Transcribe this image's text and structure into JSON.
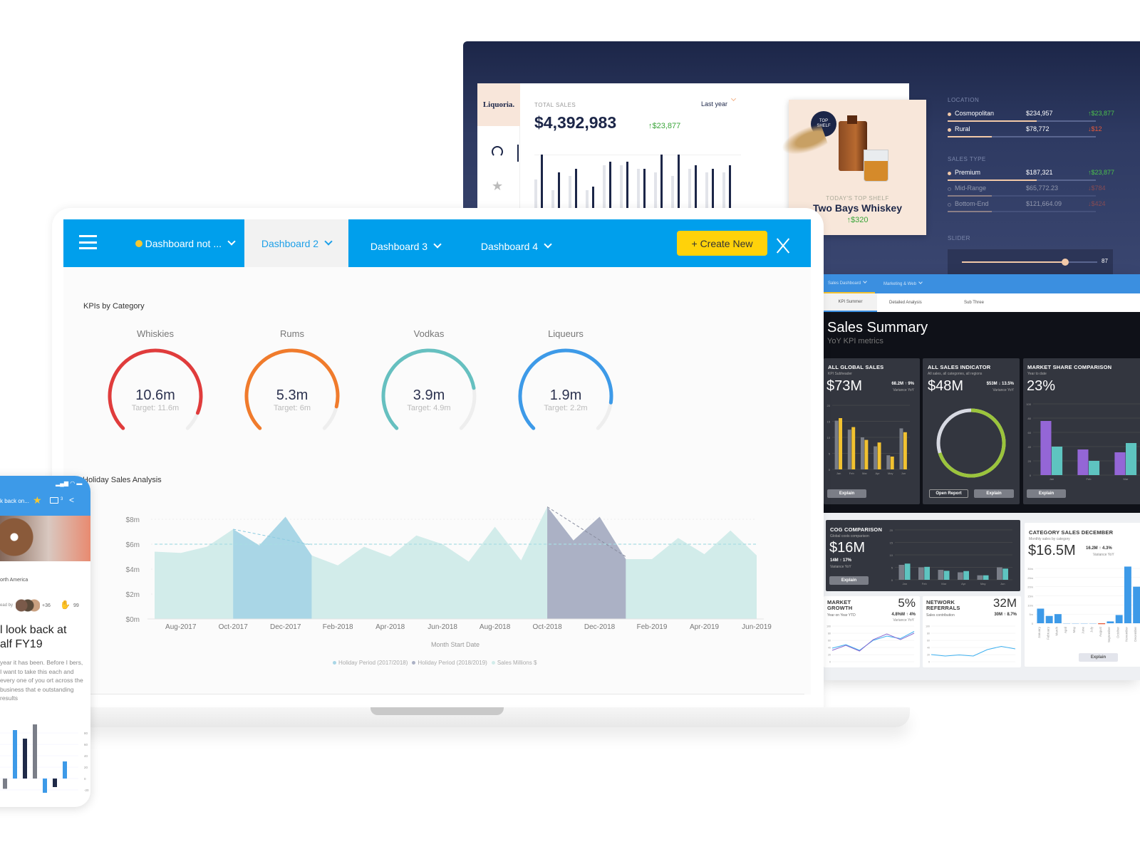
{
  "monitor": {
    "logo": "Liquoria.",
    "total_sales_label": "TOTAL SALES",
    "total_sales_value": "$4,392,983",
    "total_sales_change": "↑$23,877",
    "period_select": "Last year",
    "sidebar_icons": [
      "gauge-icon",
      "star-icon"
    ],
    "bars": [
      {
        "light": 45,
        "dark": 80
      },
      {
        "light": 30,
        "dark": 55
      },
      {
        "light": 50,
        "dark": 60
      },
      {
        "light": 30,
        "dark": 35
      },
      {
        "light": 65,
        "dark": 70
      },
      {
        "light": 65,
        "dark": 70
      },
      {
        "light": 60,
        "dark": 60
      },
      {
        "light": 55,
        "dark": 80
      },
      {
        "light": 50,
        "dark": 80
      },
      {
        "light": 60,
        "dark": 65
      },
      {
        "light": 55,
        "dark": 60
      },
      {
        "light": 55,
        "dark": 65
      }
    ],
    "product": {
      "badge": "TOP SHELF",
      "caption": "TODAY'S TOP SHELF",
      "name": "Two Bays Whiskey",
      "change": "↑$320"
    },
    "location_label": "LOCATION",
    "location": [
      {
        "name": "Cosmopolitan",
        "value": "$234,957",
        "change": "↑$23,877",
        "fill": 0.6,
        "active": true
      },
      {
        "name": "Rural",
        "value": "$78,772",
        "change": "↓$12",
        "fill": 0.3,
        "active": true
      }
    ],
    "sales_type_label": "SALES TYPE",
    "sales_type": [
      {
        "name": "Premium",
        "value": "$187,321",
        "change": "↑$23,877",
        "fill": 0.6,
        "active": true
      },
      {
        "name": "Mid-Range",
        "value": "$65,772.23",
        "change": "↓$784",
        "fill": 0.3,
        "active": false
      },
      {
        "name": "Bottom-End",
        "value": "$121,664.09",
        "change": "↓$424",
        "fill": 0.3,
        "active": false
      }
    ],
    "slider_label": "SLIDER",
    "slider_value": "87"
  },
  "laptop": {
    "tabs": [
      {
        "label": "Dashboard not ...",
        "active": false,
        "dot": true
      },
      {
        "label": "Dashboard 2",
        "active": true
      },
      {
        "label": "Dashboard 3",
        "active": false
      },
      {
        "label": "Dashboard 4",
        "active": false
      }
    ],
    "create_new": "+ Create New",
    "kpi_title": "KPIs by Category",
    "gauges": [
      {
        "label": "Whiskies",
        "value": "10.6m",
        "target": "Target: 11.6m",
        "fraction": 0.914,
        "color": "#e03c3c"
      },
      {
        "label": "Rums",
        "value": "5.3m",
        "target": "Target: 6m",
        "fraction": 0.883,
        "color": "#f07b2c"
      },
      {
        "label": "Vodkas",
        "value": "3.9m",
        "target": "Target: 4.9m",
        "fraction": 0.796,
        "color": "#66c0c0"
      },
      {
        "label": "Liqueurs",
        "value": "1.9m",
        "target": "Target: 2.2m",
        "fraction": 0.864,
        "color": "#3d9ae8"
      }
    ]
  },
  "chart_data": {
    "type": "area",
    "title": "Holiday Sales Analysis",
    "xlabel": "Month Start Date",
    "ylabel": "",
    "x": [
      "Jul-2017",
      "Aug-2017",
      "Sep-2017",
      "Oct-2017",
      "Nov-2017",
      "Dec-2017",
      "Jan-2018",
      "Feb-2018",
      "Mar-2018",
      "Apr-2018",
      "May-2018",
      "Jun-2018",
      "Jul-2018",
      "Aug-2018",
      "Sep-2018",
      "Oct-2018",
      "Nov-2018",
      "Dec-2018",
      "Jan-2019",
      "Feb-2019",
      "Mar-2019",
      "Apr-2019",
      "May-2019",
      "Jun-2019"
    ],
    "x_ticks": [
      "Aug-2017",
      "Oct-2017",
      "Dec-2017",
      "Feb-2018",
      "Apr-2018",
      "Jun-2018",
      "Aug-2018",
      "Oct-2018",
      "Dec-2018",
      "Feb-2019",
      "Apr-2019",
      "Jun-2019"
    ],
    "y_ticks": [
      "$0m",
      "$2m",
      "$4m",
      "$6m",
      "$8m"
    ],
    "ylim": [
      0,
      8
    ],
    "values": [
      5.4,
      5.3,
      5.8,
      7.2,
      5.9,
      8.2,
      5.1,
      4.3,
      5.8,
      5.0,
      6.7,
      6.0,
      4.6,
      7.4,
      4.7,
      9.0,
      6.3,
      8.2,
      4.8,
      4.8,
      6.5,
      5.2,
      7.1,
      5.1
    ],
    "average_line": 6,
    "series": [
      {
        "name": "Holiday Period (2017/2018)",
        "from": "Oct-2017",
        "to": "Jan-2018",
        "color": "#a9d6e6"
      },
      {
        "name": "Holiday Period (2018/2019)",
        "from": "Oct-2018",
        "to": "Jan-2019",
        "color": "#abb1c5"
      },
      {
        "name": "Sales Millions $",
        "color": "#d2ecea"
      }
    ],
    "legend": "bottom"
  },
  "rdash": {
    "nav": [
      {
        "label": "Sales Dashboard"
      },
      {
        "label": "Marketing & Web"
      }
    ],
    "subtabs": [
      "KPI Summer",
      "Detailed Analysis",
      "Sub Three"
    ],
    "title": "Sales Summary",
    "subtitle": "YoY KPI metrics",
    "global": {
      "title": "ALL GLOBAL SALES",
      "sub": "KPI Subheader",
      "big": "$73M",
      "var": "68.2M ↑ 9%",
      "var_label": "Variance YoY",
      "explain": "Explain",
      "months": [
        "Jan",
        "Feb",
        "Mar",
        "Apr",
        "May",
        "Jun"
      ],
      "gray": [
        19,
        15.5,
        12.5,
        9,
        5.5,
        16
      ],
      "yellow": [
        20,
        16.5,
        11.5,
        10.5,
        5,
        14.5
      ],
      "ticks": [
        "0",
        "5",
        "10",
        "15",
        "20"
      ]
    },
    "indicator": {
      "title": "ALL SALES INDICATOR",
      "sub": "All sales, all categories, all regions",
      "big": "$48M",
      "var": "$53M ↓ 13.5%",
      "var_label": "Variance YoY",
      "open": "Open Report",
      "explain": "Explain",
      "fraction": 0.7
    },
    "share": {
      "title": "MARKET SHARE COMPARISON",
      "sub": "Year to date",
      "big": "23%",
      "explain": "Explain",
      "months": [
        "Jan",
        "Feb",
        "Mar"
      ],
      "purple": [
        76,
        36,
        32
      ],
      "teal": [
        40,
        20,
        45
      ],
      "ticks": [
        "0",
        "20",
        "40",
        "60",
        "80",
        "100"
      ]
    },
    "cog": {
      "title": "COG COMPARISON",
      "sub": "Global costs comparison",
      "big": "$16M",
      "var": "14M ↑ 17%",
      "var_label": "Variance YoY",
      "explain": "Explain",
      "months": [
        "Jan",
        "Feb",
        "Mar",
        "Apr",
        "May",
        "Jun"
      ],
      "gray": [
        6,
        5,
        4,
        3,
        1.8,
        5
      ],
      "teal": [
        6.5,
        5.2,
        3.6,
        3.5,
        1.8,
        4.5
      ],
      "ticks": [
        "0",
        "5",
        "10",
        "15",
        "20"
      ]
    },
    "category": {
      "title": "CATEGORY SALES DECEMBER",
      "sub": "Monthly sales by category",
      "big": "$16.5M",
      "var": "16.2M ↑ 4.3%",
      "var_label": "Variance YoY",
      "explain": "Explain",
      "months": [
        "January",
        "February",
        "March",
        "April",
        "May",
        "June",
        "July",
        "August",
        "September",
        "October",
        "November",
        "December"
      ],
      "values": [
        8,
        4,
        5,
        0,
        0,
        0,
        0,
        -0.5,
        1,
        4.5,
        31,
        20
      ],
      "ticks": [
        "0",
        "5m",
        "10m",
        "15m",
        "20m",
        "25m",
        "30m"
      ]
    },
    "growth": {
      "title": "MARKET GROWTH",
      "sub": "Year on Year YTD",
      "big": "5%",
      "var": "4.8%M ↑ 4%",
      "var_label": "Variance YoY",
      "a": [
        38,
        48,
        32,
        60,
        72,
        65,
        85
      ],
      "b": [
        32,
        46,
        30,
        62,
        78,
        62,
        80
      ],
      "ticks": [
        "0",
        "20",
        "40",
        "60",
        "80",
        "100"
      ]
    },
    "referrals": {
      "title": "NETWORK REFERRALS",
      "sub": "Sales contribution",
      "big": "32M",
      "var": "30M ↑ 8.7%",
      "a": [
        20,
        16,
        19,
        16,
        34,
        43,
        36
      ],
      "ticks": [
        "0",
        "20",
        "40",
        "60",
        "80",
        "100"
      ]
    }
  },
  "mobile": {
    "title": "k back on...",
    "comments": "3",
    "region": "orth America",
    "read_by": "ead by",
    "readers_more": "+36",
    "claps": "99",
    "headline": "l look back at alf FY19",
    "body": "year it has been. Before I bers, I want to take this each and every one of you ort across the business that e outstanding results",
    "bars": [
      {
        "v": -18,
        "c": "#7a7e88"
      },
      {
        "v": 85,
        "c": "#3d9ae8"
      },
      {
        "v": 70,
        "c": "#1f2a48"
      },
      {
        "v": 95,
        "c": "#7a7e88"
      },
      {
        "v": -25,
        "c": "#3d9ae8"
      },
      {
        "v": -15,
        "c": "#1f2a48"
      },
      {
        "v": 30,
        "c": "#3d9ae8"
      }
    ],
    "ticks": [
      "-20",
      "0",
      "20",
      "40",
      "60",
      "80"
    ]
  }
}
